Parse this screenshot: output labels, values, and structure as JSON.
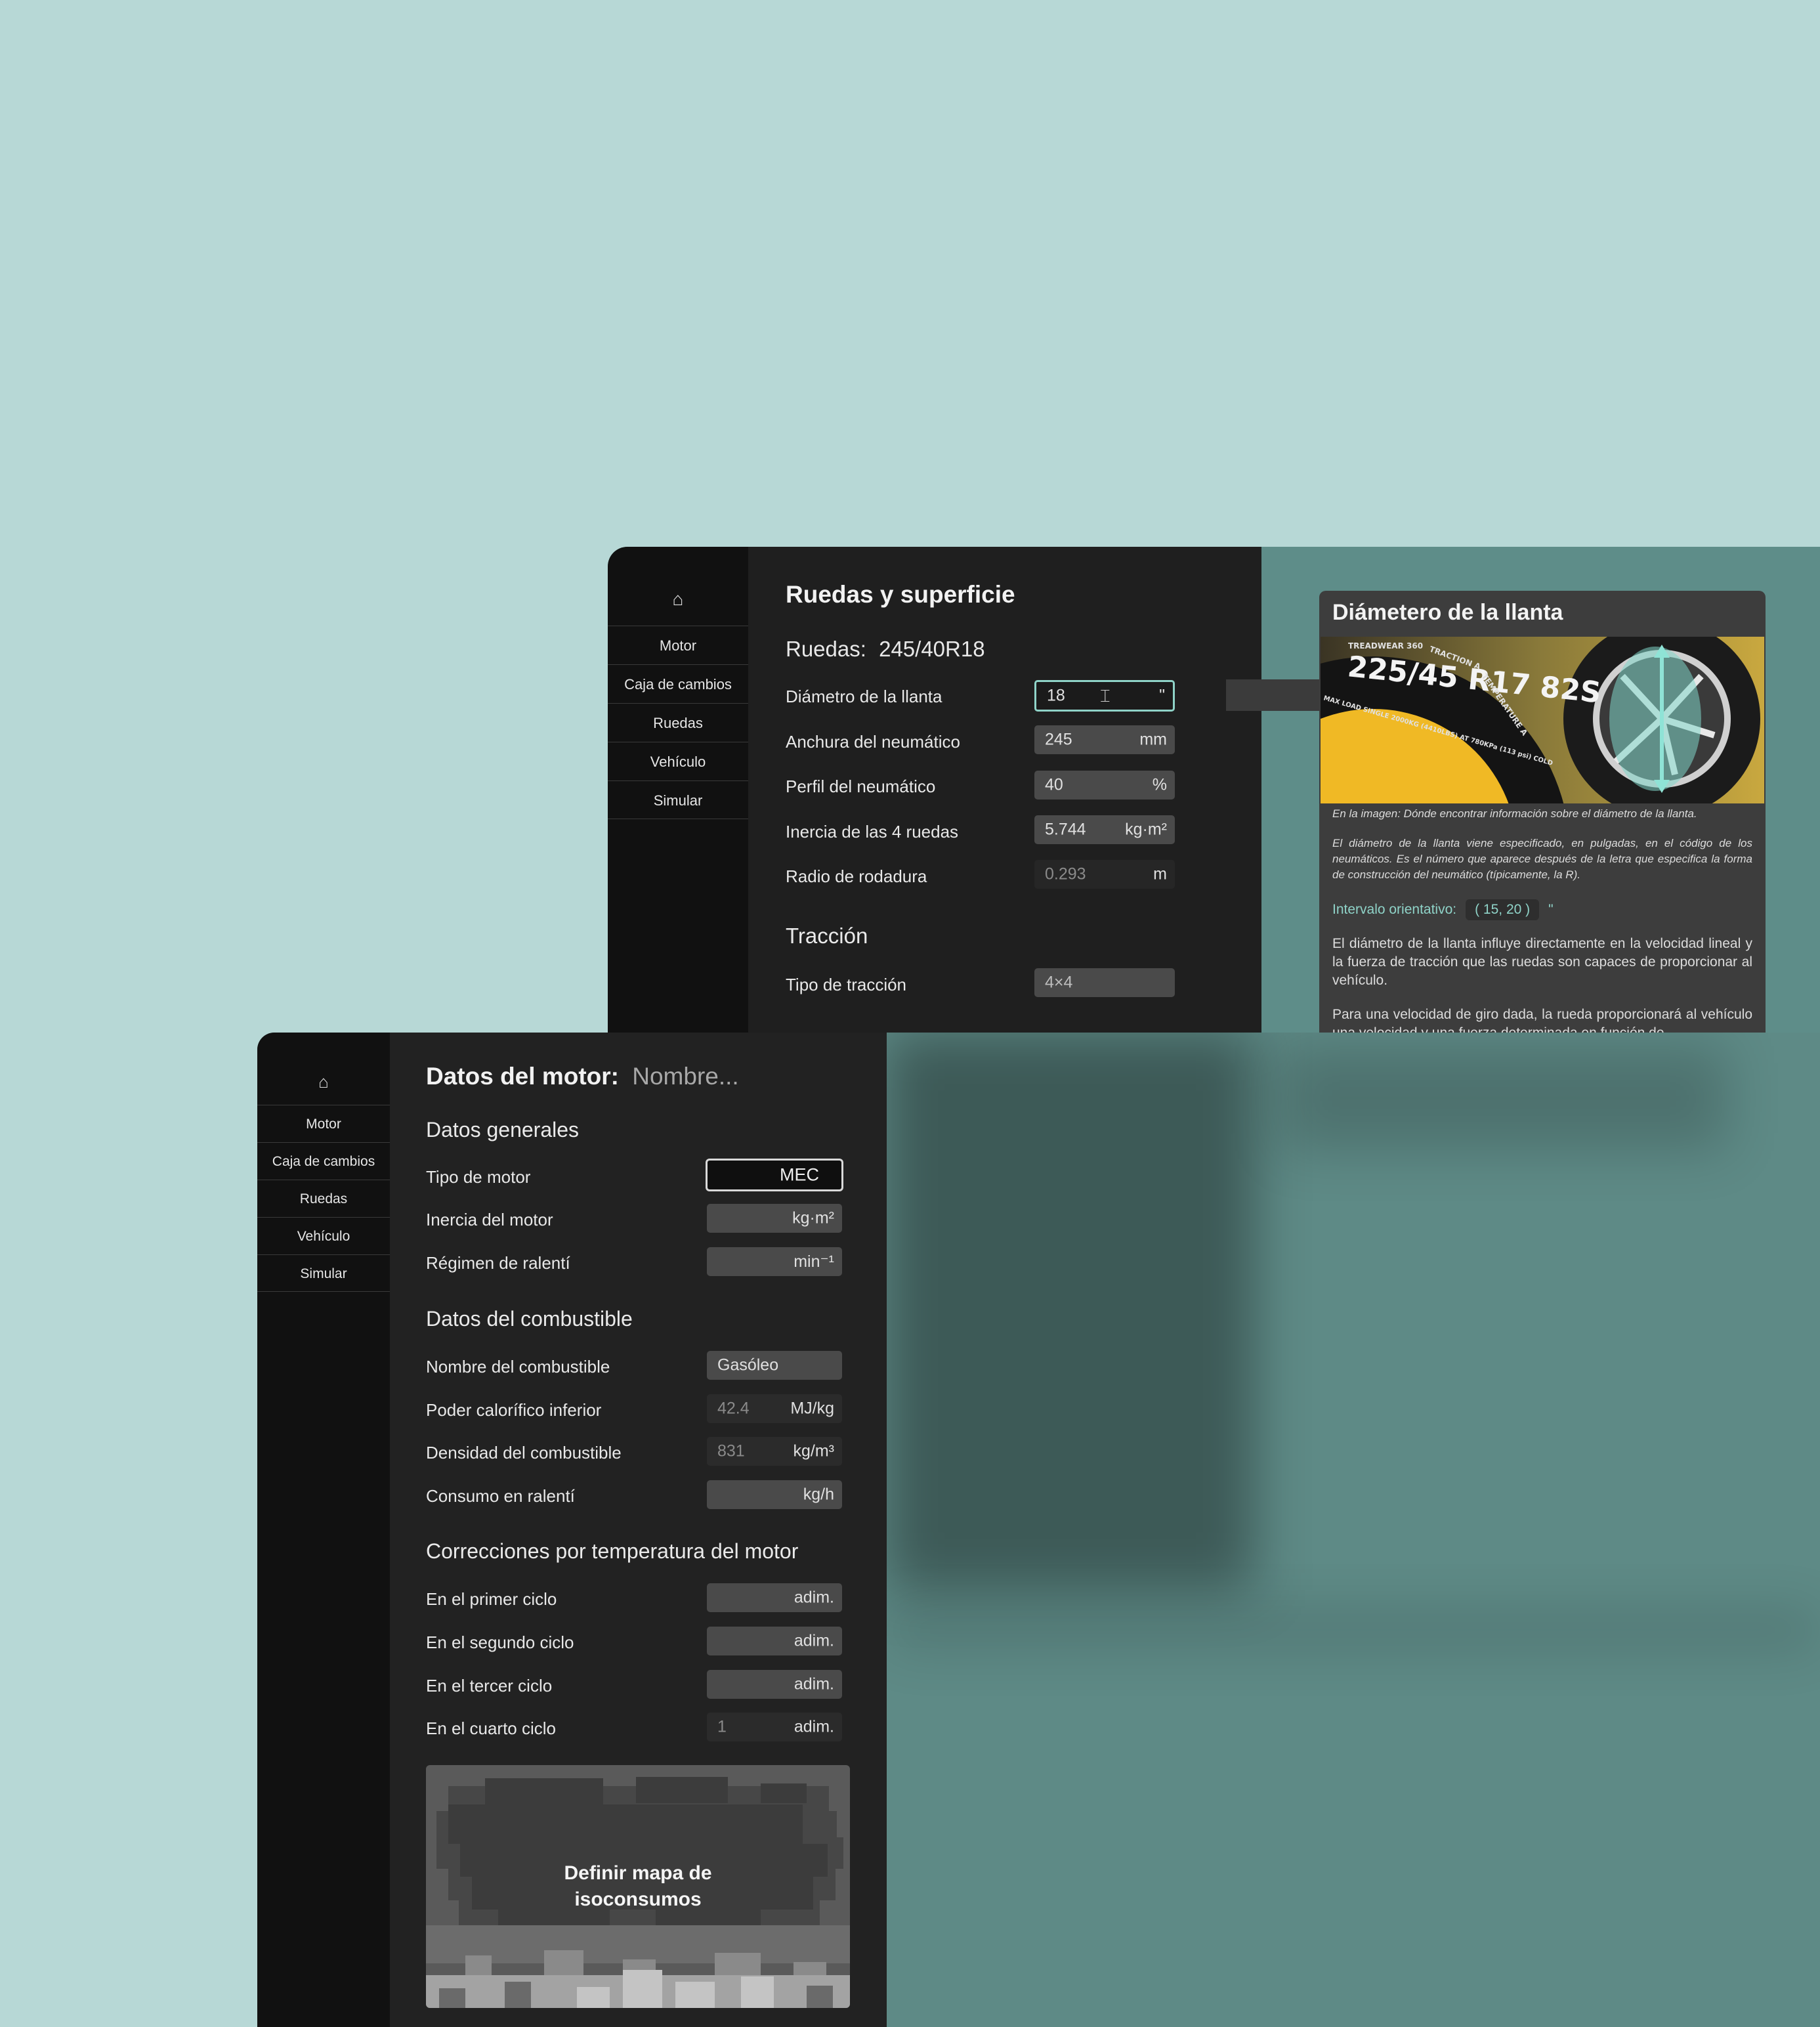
{
  "nav": {
    "home_icon": "home-icon",
    "items": [
      "Motor",
      "Caja de cambios",
      "Ruedas",
      "Vehículo",
      "Simular"
    ]
  },
  "ruedas": {
    "title": "Ruedas y superficie",
    "ruedas_label": "Ruedas:",
    "ruedas_value": "245/40R18",
    "fields": [
      {
        "label": "Diámetro de la llanta",
        "value": "18",
        "unit": "\""
      },
      {
        "label": "Anchura del neumático",
        "value": "245",
        "unit": "mm"
      },
      {
        "label": "Perfil del neumático",
        "value": "40",
        "unit": "%"
      },
      {
        "label": "Inercia de las 4 ruedas",
        "value": "5.744",
        "unit": "kg·m²"
      },
      {
        "label": "Radio de rodadura",
        "value": "0.293",
        "unit": "m"
      }
    ],
    "traccion_title": "Tracción",
    "traccion_label": "Tipo de tracción",
    "traccion_value": "4×4"
  },
  "info": {
    "title": "Diámetero de la llanta",
    "tire_text": {
      "size": "225/45 R17 82S",
      "treadwear": "TREADWEAR 360",
      "traction": "TRACTION A",
      "temperature": "TEMPERATURE A",
      "load": "MAX LOAD SINGLE 2000KG (4410LBS) AT 780KPa (113 psi) COLD"
    },
    "caption": "En la imagen: Dónde encontrar información sobre el diámetro de la llanta.",
    "description": "El diámetro de la llanta viene especificado, en pulgadas, en el código de los neumáticos. Es el número que aparece después de la letra que especifica la forma de construcción del neumático (típicamente, la R).",
    "interval_label": "Intervalo orientativo:",
    "interval_value": "( 15, 20 )",
    "interval_unit": "\"",
    "para1": "El diámetro de la llanta influye directamente en la velocidad lineal y la fuerza de tracción que las ruedas son capaces de proporcionar al vehículo.",
    "para2": "Para una velocidad de giro dada, la rueda proporcionará al vehículo una velocidad y una fuerza determinada en función de"
  },
  "motor": {
    "title": "Datos del motor:",
    "name_placeholder": "Nombre...",
    "generales_title": "Datos generales",
    "generales": [
      {
        "label": "Tipo de motor",
        "value": "MEC",
        "unit": ""
      },
      {
        "label": "Inercia del motor",
        "value": "",
        "unit": "kg·m²"
      },
      {
        "label": "Régimen de ralentí",
        "value": "",
        "unit": "min⁻¹"
      }
    ],
    "combustible_title": "Datos del combustible",
    "combustible": [
      {
        "label": "Nombre del combustible",
        "value": "Gasóleo",
        "unit": ""
      },
      {
        "label": "Poder calorífico inferior",
        "value": "42.4",
        "unit": "MJ/kg"
      },
      {
        "label": "Densidad del combustible",
        "value": "831",
        "unit": "kg/m³"
      },
      {
        "label": "Consumo en ralentí",
        "value": "",
        "unit": "kg/h"
      }
    ],
    "correcciones_title": "Correcciones por temperatura del motor",
    "correcciones": [
      {
        "label": "En el primer ciclo",
        "value": "",
        "unit": "adim."
      },
      {
        "label": "En el segundo ciclo",
        "value": "",
        "unit": "adim."
      },
      {
        "label": "En el tercer ciclo",
        "value": "",
        "unit": "adim."
      },
      {
        "label": "En el cuarto ciclo",
        "value": "1",
        "unit": "adim."
      }
    ],
    "iso_button": "Definir mapa de isoconsumos"
  },
  "colors": {
    "background": "#b7d8d6",
    "accent": "#8fd3c8",
    "panel": "#1f1f1f",
    "sidebar": "#111111",
    "tire_yellow": "#f0b925"
  }
}
